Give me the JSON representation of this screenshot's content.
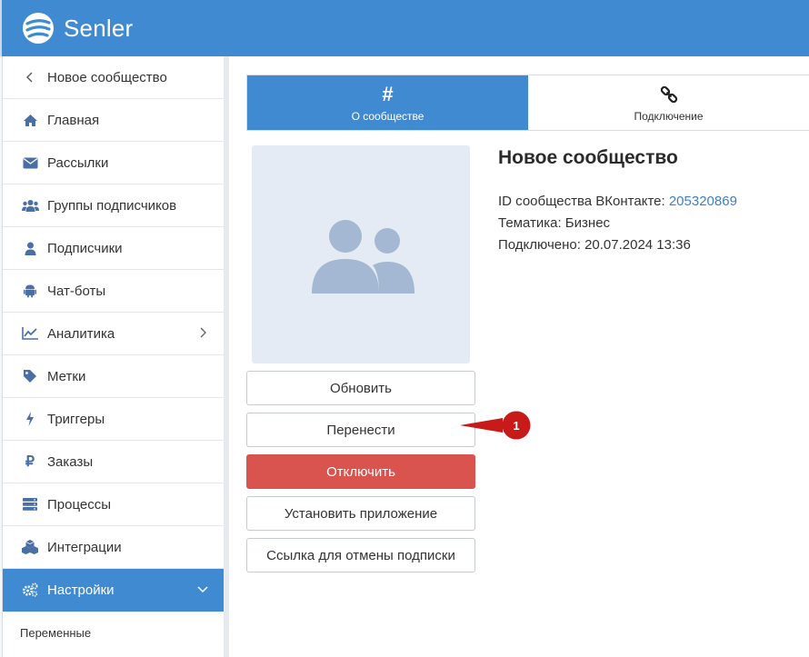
{
  "app": {
    "name": "Senler",
    "accent": "#3f8ad0",
    "danger": "#d9534f"
  },
  "sidebar": {
    "back_label": "Новое сообщество",
    "items": [
      {
        "label": "Главная",
        "icon": "home-icon"
      },
      {
        "label": "Рассылки",
        "icon": "envelope-icon"
      },
      {
        "label": "Группы подписчиков",
        "icon": "users-icon"
      },
      {
        "label": "Подписчики",
        "icon": "user-icon"
      },
      {
        "label": "Чат-боты",
        "icon": "android-icon"
      },
      {
        "label": "Аналитика",
        "icon": "line-chart-icon"
      },
      {
        "label": "Метки",
        "icon": "tag-icon"
      },
      {
        "label": "Триггеры",
        "icon": "bolt-icon"
      },
      {
        "label": "Заказы",
        "icon": "ruble-icon"
      },
      {
        "label": "Процессы",
        "icon": "server-icon"
      },
      {
        "label": "Интеграции",
        "icon": "cubes-icon"
      },
      {
        "label": "Настройки",
        "icon": "cogs-icon"
      }
    ],
    "sub_item": "Переменные"
  },
  "tabs": [
    {
      "label": "О сообществе",
      "icon": "hashtag-icon"
    },
    {
      "label": "Подключение",
      "icon": "link-icon"
    }
  ],
  "community": {
    "title": "Новое сообщество",
    "id_label": "ID сообщества ВКонтакте:",
    "id_value": "205320869",
    "theme": "Тематика: Бизнес",
    "connected": "Подключено: 20.07.2024 13:36"
  },
  "buttons": {
    "refresh": "Обновить",
    "transfer": "Перенести",
    "disconnect": "Отключить",
    "install": "Установить приложение",
    "unsubscribe_link": "Ссылка для отмены подписки"
  },
  "callout": {
    "number": "1"
  }
}
